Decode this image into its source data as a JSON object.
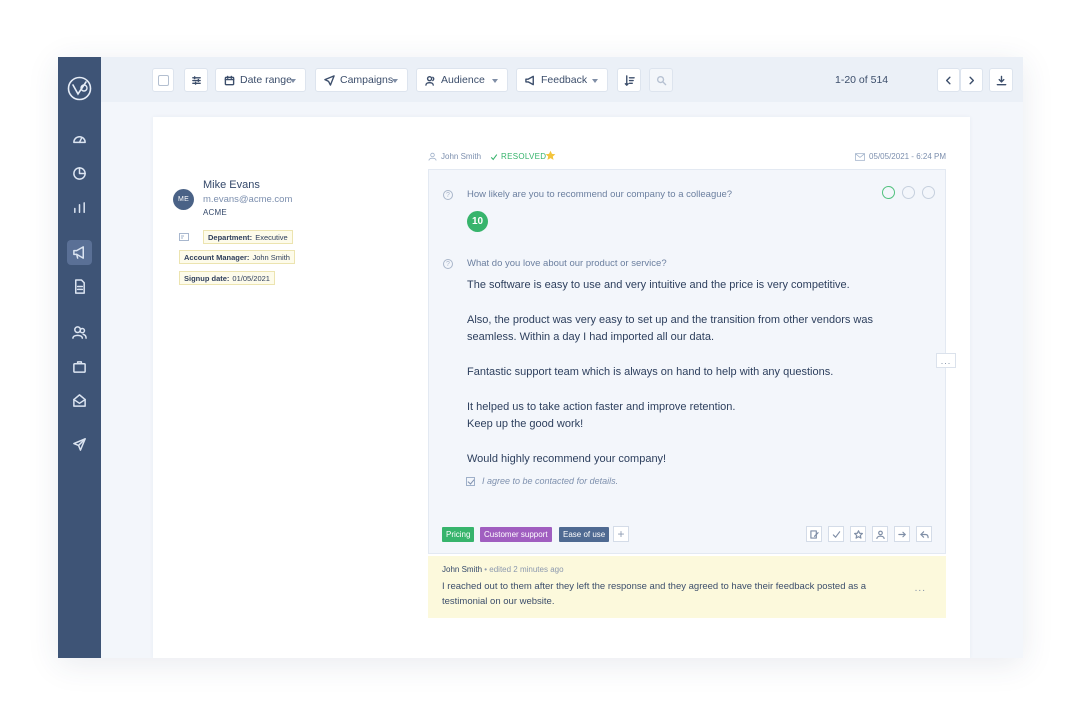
{
  "toolbar": {
    "date_range": "Date range",
    "campaigns": "Campaigns",
    "audience": "Audience",
    "feedback": "Feedback",
    "pagination": "1-20 of 514"
  },
  "contact": {
    "initials": "ME",
    "name": "Mike Evans",
    "email": "m.evans@acme.com",
    "company": "ACME",
    "department_label": "Department:",
    "department_value": "Executive",
    "manager_label": "Account Manager:",
    "manager_value": "John Smith",
    "signup_label": "Signup date:",
    "signup_value": "01/05/2021"
  },
  "response": {
    "assignee": "John Smith",
    "status": "RESOLVED",
    "date": "05/05/2021 - 6:24 PM",
    "q1": "How likely are you to recommend our company to a colleague?",
    "score": "10",
    "q2": "What do you love about our product or service?",
    "answer_1": "The software is easy to use and very intuitive and the price is very competitive.",
    "answer_2": "Also, the product was very easy to set up and the transition from other vendors was seamless. Within a day I had imported all our data.",
    "answer_3": "Fantastic support team which is always on hand to help with any questions.",
    "answer_4": "It helped us to take action faster and improve retention.",
    "answer_5": "Keep up the good work!",
    "answer_6": "Would highly recommend your company!",
    "consent": "I agree to be contacted for details.",
    "tags": [
      {
        "label": "Pricing",
        "color": "#37b46c"
      },
      {
        "label": "Customer support",
        "color": "#a05ec0"
      },
      {
        "label": "Ease of use",
        "color": "#4f6a92"
      }
    ],
    "add_tag": "+",
    "more": "..."
  },
  "note": {
    "author": "John Smith",
    "edited": " • edited 2 minutes ago",
    "text": "I reached out to them after they left the response and they agreed to have their feedback posted as a testimonial on our website.",
    "more": "..."
  },
  "colors": {
    "sidebar": "#3e5476",
    "accent_green": "#37b46c",
    "note_bg": "#fcf9dc"
  }
}
